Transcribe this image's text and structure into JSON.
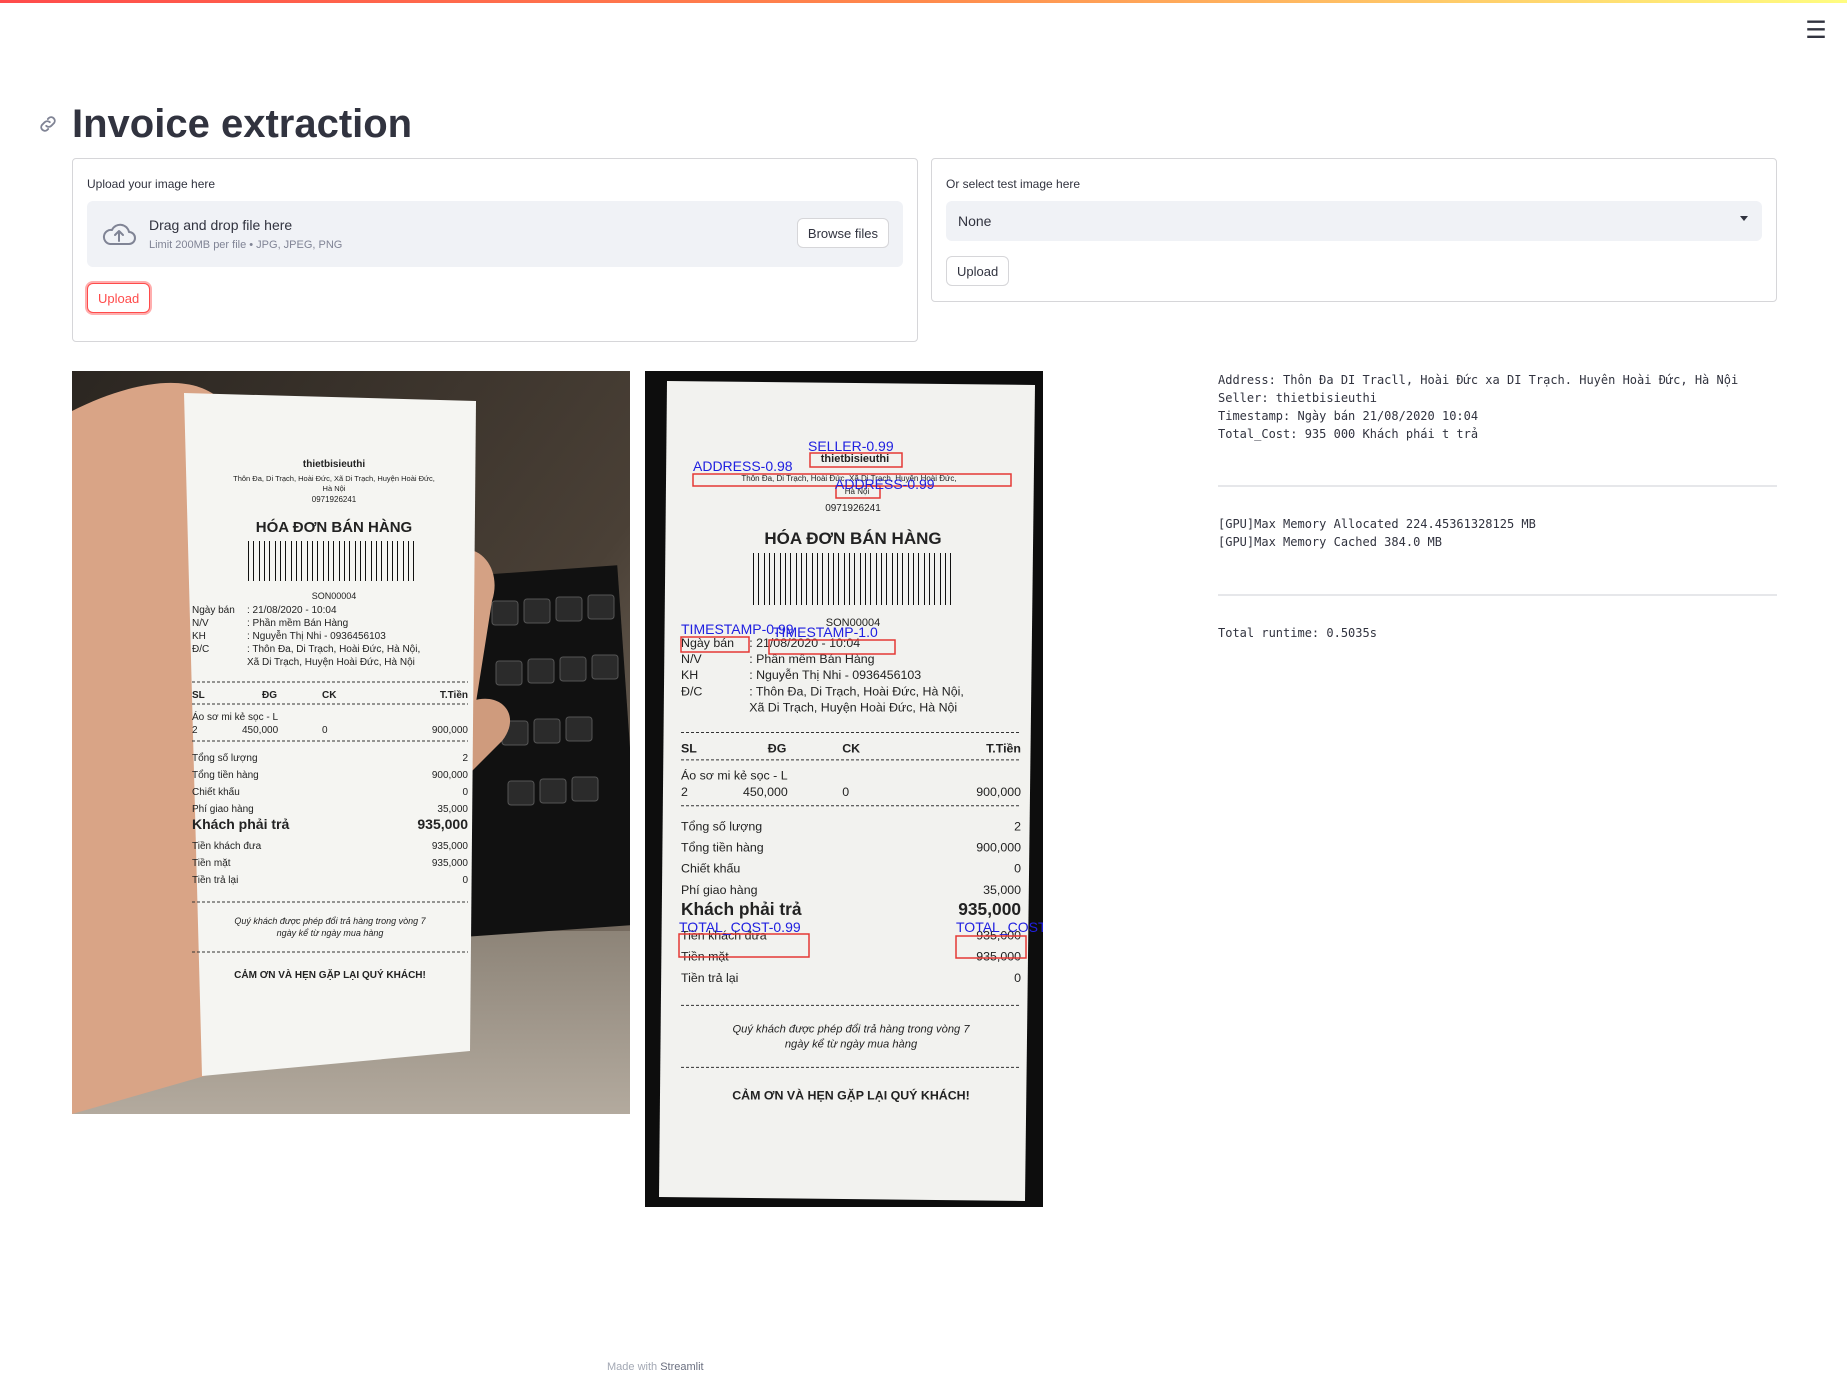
{
  "app": {
    "title": "Invoice extraction",
    "menu_icon": "hamburger-menu-icon",
    "footer_prefix": "Made with",
    "footer_brand": "Streamlit"
  },
  "upload": {
    "label": "Upload your image here",
    "drag_text": "Drag and drop file here",
    "limit_text": "Limit 200MB per file • JPG, JPEG, PNG",
    "browse_label": "Browse files",
    "button_label": "Upload"
  },
  "select_test": {
    "label": "Or select test image here",
    "selected": "None",
    "button_label": "Upload"
  },
  "receipt": {
    "store": "thietbisieuthi",
    "address_line1": "Thôn Đa, Di Trạch, Hoài Đức, Xã Di Trạch, Huyện Hoài Đức,",
    "address_line2": "Hà Nội",
    "phone": "0971926241",
    "heading": "HÓA ĐƠN BÁN HÀNG",
    "code": "SON00004",
    "info": [
      {
        "k": "Ngày bán",
        "v": ": 21/08/2020 - 10:04"
      },
      {
        "k": "N/V",
        "v": ": Phần mềm Bán Hàng"
      },
      {
        "k": "KH",
        "v": ": Nguyễn Thị Nhi - 0936456103"
      },
      {
        "k": "Đ/C",
        "v": ": Thôn Đa, Di Trạch, Hoài Đức, Hà Nội,"
      },
      {
        "k": "",
        "v": "  Xã Di Trạch, Huyện Hoài Đức, Hà Nội"
      }
    ],
    "columns": [
      "SL",
      "ĐG",
      "CK",
      "T.Tiền"
    ],
    "item_name": "Áo sơ mi kẻ sọc - L",
    "item": [
      "2",
      "450,000",
      "0",
      "900,000"
    ],
    "summary": [
      {
        "k": "Tổng số lượng",
        "v": "2"
      },
      {
        "k": "Tổng tiền hàng",
        "v": "900,000"
      },
      {
        "k": "Chiết khấu",
        "v": "0"
      },
      {
        "k": "Phí giao hàng",
        "v": "35,000"
      },
      {
        "k": "Khách phải trả",
        "v": "935,000"
      },
      {
        "k": "Tiền khách đưa",
        "v": "935,000"
      },
      {
        "k": "Tiền mặt",
        "v": "935,000"
      },
      {
        "k": "Tiền trả lại",
        "v": "0"
      }
    ],
    "note1": "Quý khách được phép đổi trả hàng trong vòng 7",
    "note2": "ngày kể từ ngày mua hàng",
    "thanks": "CẢM ƠN VÀ HẸN GẶP LẠI QUÝ KHÁCH!"
  },
  "detections": {
    "seller": "SELLER-0.99",
    "address1": "ADDRESS-0.98",
    "address2": "ADDRESS-0.99",
    "timestamp1": "TIMESTAMP-0.99",
    "timestamp2": "TIMESTAMP-1.0",
    "total1": "TOTAL_COST-0.99",
    "total2": "TOTAL_COST",
    "box_color": "#e53935",
    "label_color": "#2020e0"
  },
  "results": {
    "extracted": "Address: Thôn Đa DI Tracll, Hoài Đức xa DI Trạch. Huyên Hoài Đức, Hà Nội\nSeller: thietbisieuthi\nTimestamp: Ngày bán 21/08/2020 10:04\nTotal_Cost: 935 000 Khách phái t trả",
    "gpu": "[GPU]Max Memory Allocated 224.45361328125 MB\n[GPU]Max Memory Cached 384.0 MB",
    "runtime": "Total runtime: 0.5035s"
  },
  "colors": {
    "accent": "#ff4b4b",
    "text": "#31333f",
    "input_bg": "#f0f2f6"
  }
}
